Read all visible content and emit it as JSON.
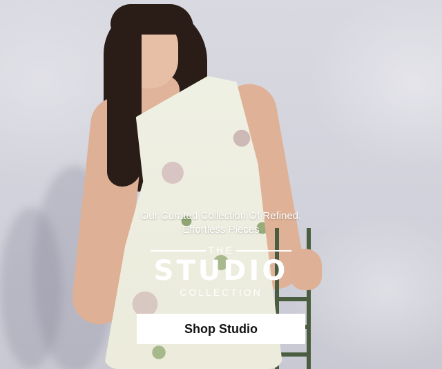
{
  "hero": {
    "tagline_line1": "Our Curated Collection Of Refined,",
    "tagline_line2": "Effortless Pieces",
    "logo": {
      "the": "THE",
      "studio": "STUDIO",
      "collection": "COLLECTION"
    },
    "cta_label": "Shop Studio",
    "colors": {
      "text": "#ffffff",
      "button_bg": "#ffffff",
      "button_text": "#111111"
    }
  }
}
